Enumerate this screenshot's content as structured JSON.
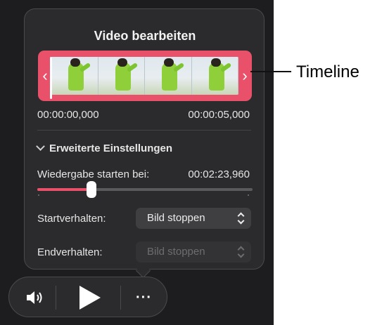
{
  "popover": {
    "title": "Video bearbeiten",
    "timeline": {
      "start_time": "00:00:00,000",
      "end_time": "00:00:05,000",
      "left_handle": "‹",
      "right_handle": "›",
      "accent_color": "#e9506a"
    },
    "advanced": {
      "header": "Erweiterte Einstellungen",
      "playback_label": "Wiedergabe starten bei:",
      "playback_value": "00:02:23,960",
      "slider_fraction": 0.25,
      "start_behavior_label": "Startverhalten:",
      "start_behavior_value": "Bild stoppen",
      "end_behavior_label": "Endverhalten:",
      "end_behavior_value": "Bild stoppen"
    }
  },
  "controls": {
    "volume_icon": "speaker-icon",
    "play_icon": "play-icon",
    "more_label": "···"
  },
  "callout": {
    "label": "Timeline"
  }
}
